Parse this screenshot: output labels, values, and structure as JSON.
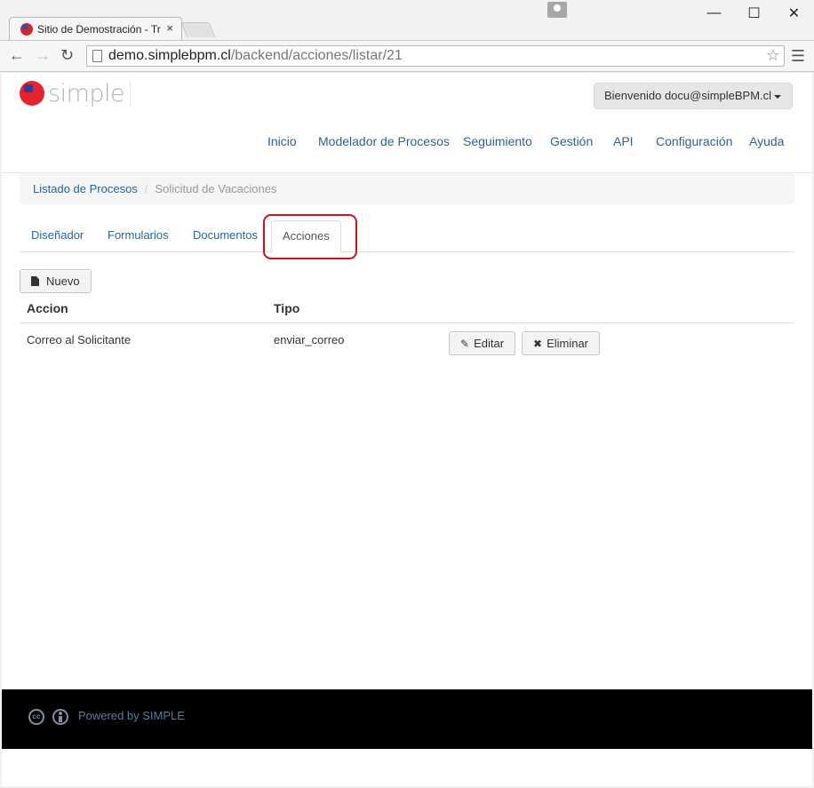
{
  "browser": {
    "tab_title": "Sitio de Demostración - Tr",
    "tab_close": "×",
    "url_host": "demo.simplebpm.cl",
    "url_path": "/backend/acciones/listar/21",
    "window_min": "—",
    "window_max": "☐",
    "window_close": "✕"
  },
  "header": {
    "logo_text": "simple",
    "user_button": "Bienvenido docu@simpleBPM.cl"
  },
  "nav": {
    "items": [
      "Inicio",
      "Modelador de Procesos",
      "Seguimiento",
      "Gestión",
      "API",
      "Configuración",
      "Ayuda"
    ]
  },
  "breadcrumb": {
    "link": "Listado de Procesos",
    "separator": "/",
    "current": "Solicitud de Vacaciones"
  },
  "tabs": [
    "Diseñador",
    "Formularios",
    "Documentos",
    "Acciones"
  ],
  "toolbar": {
    "new_label": "Nuevo"
  },
  "table": {
    "headers": [
      "Accion",
      "Tipo"
    ],
    "rows": [
      {
        "accion": "Correo al Solicitante",
        "tipo": "enviar_correo",
        "edit_label": "Editar",
        "delete_label": "Eliminar"
      }
    ]
  },
  "footer": {
    "cc_label": "cc",
    "text": "Powered by SIMPLE"
  },
  "colors": {
    "link": "#2a6496",
    "highlight": "#d0111b",
    "footer_bg": "#000000"
  }
}
